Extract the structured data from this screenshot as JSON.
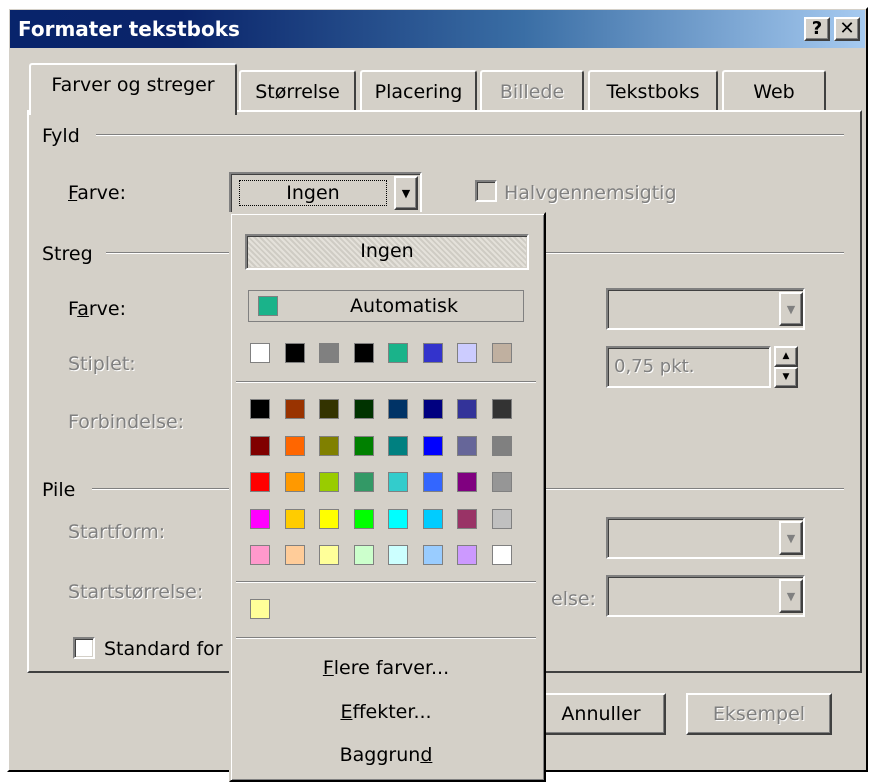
{
  "window": {
    "title": "Formater tekstboks",
    "help_label": "?",
    "close_label": "✕"
  },
  "tabs": [
    {
      "label": "Farver og streger",
      "state": "active"
    },
    {
      "label": "Størrelse",
      "state": "normal"
    },
    {
      "label": "Placering",
      "state": "normal"
    },
    {
      "label": "Billede",
      "state": "disabled"
    },
    {
      "label": "Tekstboks",
      "state": "normal"
    },
    {
      "label": "Web",
      "state": "normal"
    }
  ],
  "fill": {
    "section": "Fyld",
    "color_label_pre": "",
    "color_label_u": "F",
    "color_label_post": "arve:",
    "color_value": "Ingen",
    "transparent_label": "Halvgennemsigtig"
  },
  "line": {
    "section": "Streg",
    "color_label_pre": "F",
    "color_label_u": "a",
    "color_label_post": "rve:",
    "dash_label": "Stiplet:",
    "connector_label": "Forbindelse:",
    "weight_value": "0,75 pkt."
  },
  "arrows": {
    "section": "Pile",
    "start_style_label": "Startform:",
    "start_size_label": "Startstørrelse:",
    "end_size_fragment": "else:"
  },
  "default_checkbox": {
    "label": "Standard for"
  },
  "buttons": {
    "cancel": "Annuller",
    "preview": "Eksempel"
  },
  "dropdown": {
    "none_label": "Ingen",
    "auto_label": "Automatisk",
    "auto_color": "#1ab38a",
    "recent_colors": [
      "#ffffff",
      "#000000",
      "#808080",
      "#000000",
      "#1ab38a",
      "#3333cc",
      "#ccccff",
      "#c0b0a0"
    ],
    "palette": [
      [
        "#000000",
        "#993300",
        "#333300",
        "#003300",
        "#003366",
        "#000080",
        "#333399",
        "#333333"
      ],
      [
        "#800000",
        "#ff6600",
        "#808000",
        "#008000",
        "#008080",
        "#0000ff",
        "#666699",
        "#808080"
      ],
      [
        "#ff0000",
        "#ff9900",
        "#99cc00",
        "#339966",
        "#33cccc",
        "#3366ff",
        "#800080",
        "#969696"
      ],
      [
        "#ff00ff",
        "#ffcc00",
        "#ffff00",
        "#00ff00",
        "#00ffff",
        "#00ccff",
        "#993366",
        "#c0c0c0"
      ],
      [
        "#ff99cc",
        "#ffcc99",
        "#ffff99",
        "#ccffcc",
        "#ccffff",
        "#99ccff",
        "#cc99ff",
        "#ffffff"
      ]
    ],
    "custom_colors": [
      "#ffff99"
    ],
    "more_colors": {
      "u": "F",
      "rest": "lere farver..."
    },
    "effects": {
      "u": "E",
      "rest": "ffekter..."
    },
    "background": {
      "pre": "Baggrun",
      "u": "d"
    }
  }
}
